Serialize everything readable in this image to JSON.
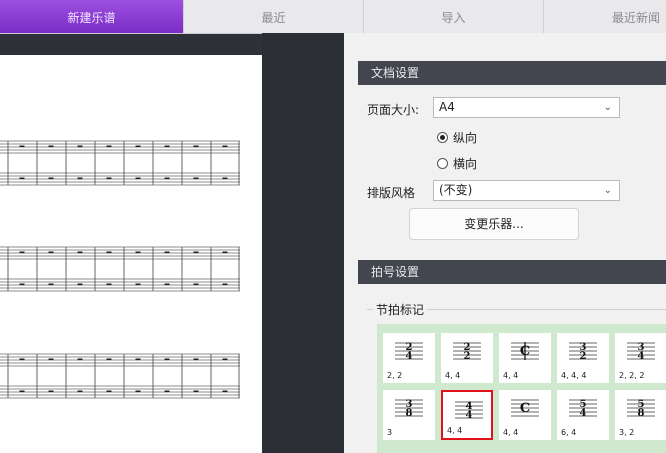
{
  "tabs": [
    {
      "label": "新建乐谱",
      "active": true
    },
    {
      "label": "最近",
      "active": false
    },
    {
      "label": "导入",
      "active": false
    },
    {
      "label": "最近新闻",
      "active": false
    }
  ],
  "document_settings": {
    "header": "文档设置",
    "page_size_label": "页面大小:",
    "page_size_value": "A4",
    "orientation_portrait": "纵向",
    "orientation_landscape": "横向",
    "orientation_selected": "纵向",
    "layout_style_label": "排版风格",
    "layout_style_value": "(不变)",
    "change_instruments_label": "变更乐器..."
  },
  "time_signature_settings": {
    "header": "拍号设置",
    "group_label": "节拍标记",
    "items": [
      {
        "symbol": "2/4",
        "caption": "2, 2",
        "selected": false
      },
      {
        "symbol": "2/2",
        "caption": "4, 4",
        "selected": false
      },
      {
        "symbol": "C|",
        "caption": "4, 4",
        "selected": false
      },
      {
        "symbol": "3/2",
        "caption": "4, 4, 4",
        "selected": false
      },
      {
        "symbol": "3/4",
        "caption": "2, 2, 2",
        "selected": false
      },
      {
        "symbol": "3/8",
        "caption": "3",
        "selected": false
      },
      {
        "symbol": "4/4",
        "caption": "4, 4",
        "selected": true
      },
      {
        "symbol": "C",
        "caption": "4, 4",
        "selected": false
      },
      {
        "symbol": "5/4",
        "caption": "6, 4",
        "selected": false
      },
      {
        "symbol": "5/8",
        "caption": "3, 2",
        "selected": false
      }
    ]
  },
  "colors": {
    "accent": "#8a3fd6",
    "selection": "#e0121a",
    "grid_bg": "#cfe9cf",
    "header_bg": "#43464e"
  }
}
